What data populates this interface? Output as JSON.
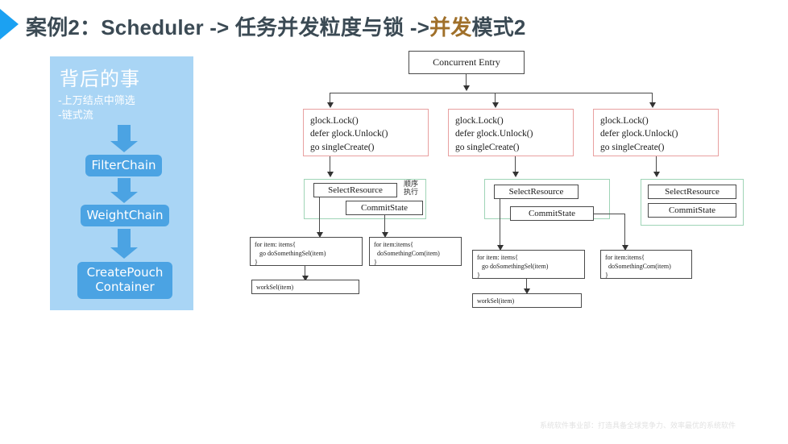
{
  "slide": {
    "title_main": "案例2：Scheduler -> 任务并发粒度与锁 ->",
    "title_highlight": "并发",
    "title_tail": "模式2",
    "footer": "系统软件事业部：打造具备全球竞争力、效率最优的系统软件",
    "accent_blue": "#1ba1f2",
    "highlight_color": "#a0702a",
    "title_color": "#3b4a54"
  },
  "left_panel": {
    "background": "#a9d5f5",
    "box_color": "#4ba3e3",
    "heading": "背后的事",
    "bullets": [
      "-上万结点中筛选",
      "-链式流"
    ],
    "chain": [
      {
        "label": "FilterChain"
      },
      {
        "label": "WeightChain"
      },
      {
        "label": "CreatePouch\nContainer",
        "line1": "CreatePouch",
        "line2": "Container"
      }
    ]
  },
  "flow": {
    "entry": {
      "label": "Concurrent Entry"
    },
    "lock_boxes": [
      {
        "code": "glock.Lock()\ndefer glock.Unlock()\ngo singleCreate()"
      },
      {
        "code": "glock.Lock()\ndefer glock.Unlock()\ngo singleCreate()"
      },
      {
        "code": "glock.Lock()\ndefer glock.Unlock()\ngo singleCreate()"
      }
    ],
    "groups": [
      {
        "select_resource": "SelectResource",
        "commit_state": "CommitState",
        "note_line1": "顺序",
        "note_line2": "执行"
      },
      {
        "select_resource": "SelectResource",
        "commit_state": "CommitState"
      },
      {
        "select_resource": "SelectResource",
        "commit_state": "CommitState"
      }
    ],
    "code_boxes": [
      {
        "code": "for item: items{\n   go doSomethingSel(item)\n}"
      },
      {
        "code": "for item:items{\n  doSomethingCom(item)\n}"
      },
      {
        "code": "for item: items{\n   go doSomethingSel(item)\n}"
      },
      {
        "code": "for item:items{\n  doSomethingCom(item)\n}"
      }
    ],
    "work_boxes": [
      {
        "code": "workSel(item)"
      },
      {
        "code": "workSel(item)"
      }
    ],
    "border_colors": {
      "lock": "#e8a0a0",
      "group": "#9fd4b6",
      "default": "#4a4a4a"
    }
  }
}
